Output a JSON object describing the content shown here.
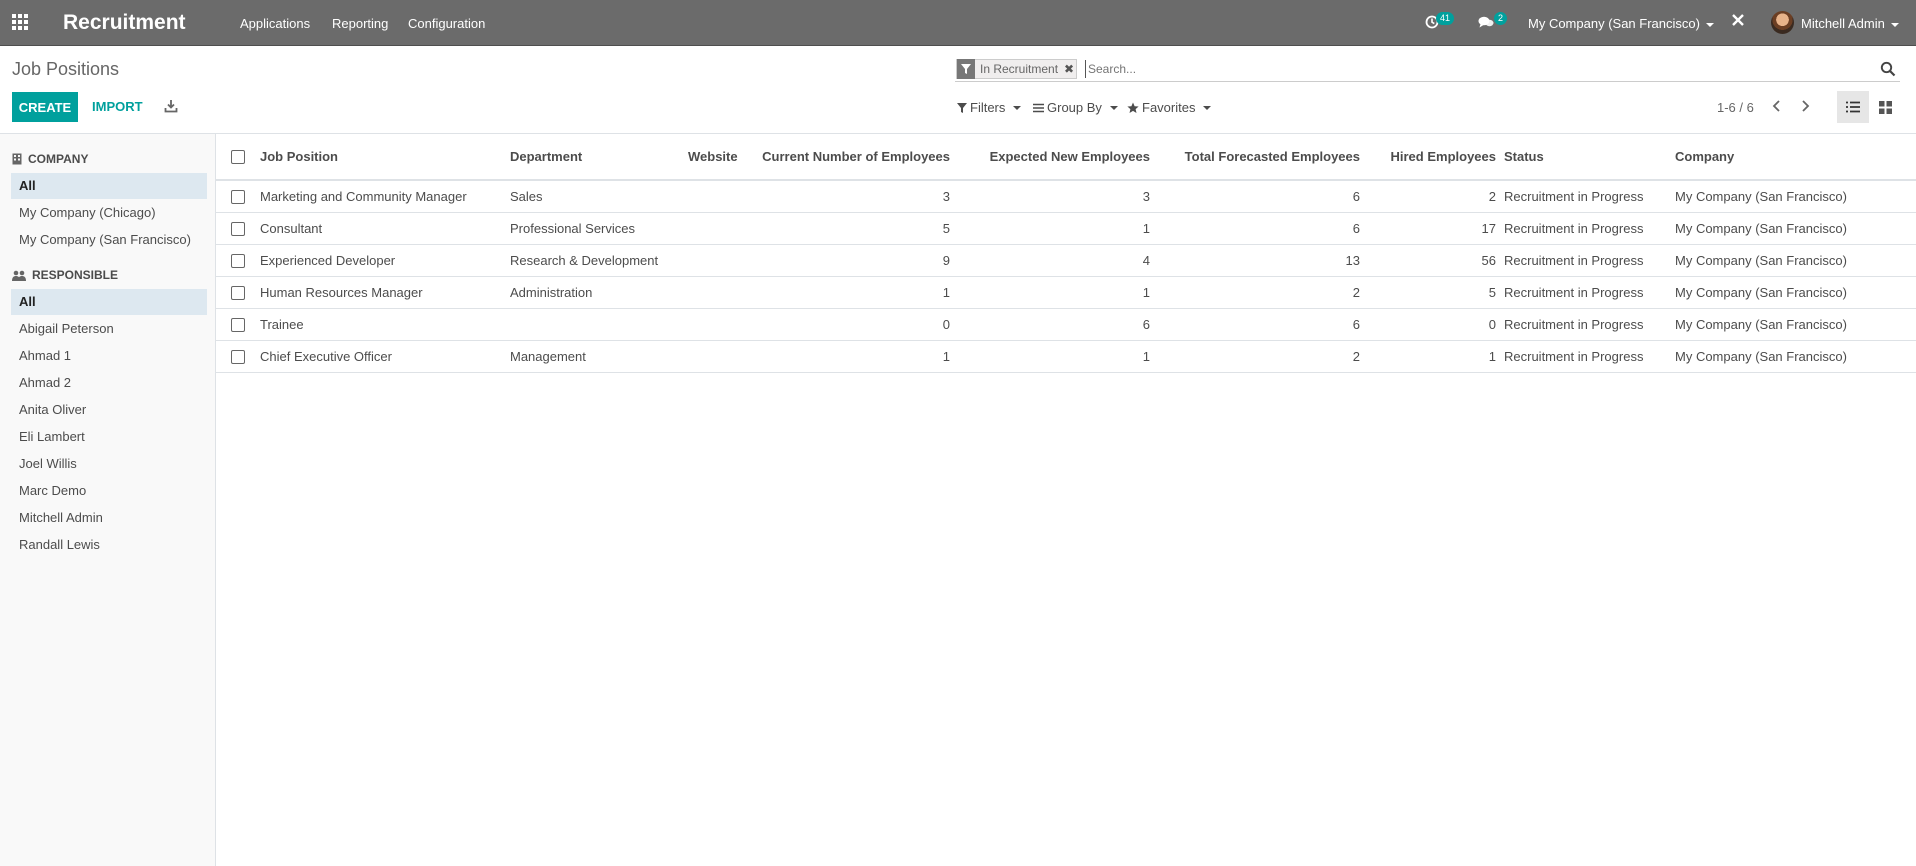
{
  "navbar": {
    "app_title": "Recruitment",
    "menus": [
      "Applications",
      "Reporting",
      "Configuration"
    ],
    "activity_count": "41",
    "message_count": "2",
    "company_switch": "My Company (San Francisco)",
    "user_name": "Mitchell Admin"
  },
  "control_panel": {
    "breadcrumb": "Job Positions",
    "create_label": "CREATE",
    "import_label": "IMPORT",
    "facet_label": "In Recruitment",
    "search_placeholder": "Search...",
    "filters_label": "Filters",
    "groupby_label": "Group By",
    "favorites_label": "Favorites",
    "pager": "1-6 / 6"
  },
  "sidepanel": {
    "company_header": "COMPANY",
    "companies": [
      "All",
      "My Company (Chicago)",
      "My Company (San Francisco)"
    ],
    "responsible_header": "RESPONSIBLE",
    "responsibles": [
      "All",
      "Abigail Peterson",
      "Ahmad 1",
      "Ahmad 2",
      "Anita Oliver",
      "Eli Lambert",
      "Joel Willis",
      "Marc Demo",
      "Mitchell Admin",
      "Randall Lewis"
    ]
  },
  "table": {
    "columns": [
      "Job Position",
      "Department",
      "Website",
      "Current Number of Employees",
      "Expected New Employees",
      "Total Forecasted Employees",
      "Hired Employees",
      "Status",
      "Company"
    ],
    "rows": [
      [
        "Marketing and Community Manager",
        "Sales",
        "",
        "3",
        "3",
        "6",
        "2",
        "Recruitment in Progress",
        "My Company (San Francisco)"
      ],
      [
        "Consultant",
        "Professional Services",
        "",
        "5",
        "1",
        "6",
        "17",
        "Recruitment in Progress",
        "My Company (San Francisco)"
      ],
      [
        "Experienced Developer",
        "Research & Development",
        "",
        "9",
        "4",
        "13",
        "56",
        "Recruitment in Progress",
        "My Company (San Francisco)"
      ],
      [
        "Human Resources Manager",
        "Administration",
        "",
        "1",
        "1",
        "2",
        "5",
        "Recruitment in Progress",
        "My Company (San Francisco)"
      ],
      [
        "Trainee",
        "",
        "",
        "0",
        "6",
        "6",
        "0",
        "Recruitment in Progress",
        "My Company (San Francisco)"
      ],
      [
        "Chief Executive Officer",
        "Management",
        "",
        "1",
        "1",
        "2",
        "1",
        "Recruitment in Progress",
        "My Company (San Francisco)"
      ]
    ]
  },
  "colors": {
    "accent": "#00a09d",
    "navbar": "#6b6b6b",
    "active_bg": "#dde8f0"
  }
}
